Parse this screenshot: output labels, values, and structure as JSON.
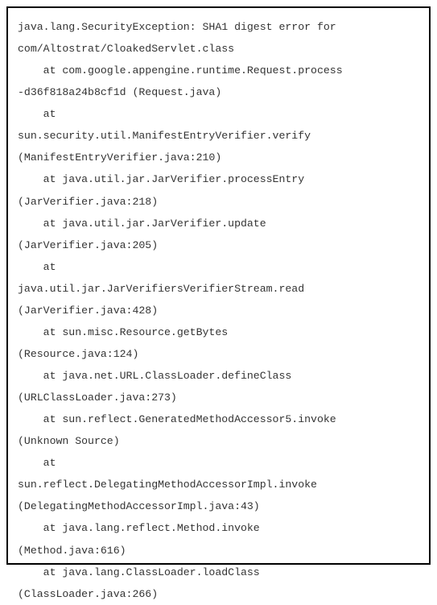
{
  "stacktrace": {
    "exception_line1": "java.lang.SecurityException: SHA1 digest error for",
    "exception_line2": "com/Altostrat/CloakedServlet.class",
    "frames": [
      {
        "at": "    at com.google.appengine.runtime.Request.process",
        "loc": "-d36f818a24b8cf1d (Request.java)"
      },
      {
        "at": "    at",
        "loc": "sun.security.util.ManifestEntryVerifier.verify",
        "loc2": "(ManifestEntryVerifier.java:210)"
      },
      {
        "at": "    at java.util.jar.JarVerifier.processEntry",
        "loc": "(JarVerifier.java:218)"
      },
      {
        "at": "    at java.util.jar.JarVerifier.update",
        "loc": "(JarVerifier.java:205)"
      },
      {
        "at": "    at",
        "loc": "java.util.jar.JarVerifiersVerifierStream.read",
        "loc2": "(JarVerifier.java:428)"
      },
      {
        "at": "    at sun.misc.Resource.getBytes",
        "loc": "(Resource.java:124)"
      },
      {
        "at": "    at java.net.URL.ClassLoader.defineClass",
        "loc": "(URLClassLoader.java:273)"
      },
      {
        "at": "    at sun.reflect.GeneratedMethodAccessor5.invoke",
        "loc": "(Unknown Source)"
      },
      {
        "at": "    at",
        "loc": "sun.reflect.DelegatingMethodAccessorImpl.invoke",
        "loc2": "(DelegatingMethodAccessorImpl.java:43)"
      },
      {
        "at": "    at java.lang.reflect.Method.invoke",
        "loc": "(Method.java:616)"
      },
      {
        "at": "    at java.lang.ClassLoader.loadClass",
        "loc": "(ClassLoader.java:266)"
      }
    ]
  }
}
